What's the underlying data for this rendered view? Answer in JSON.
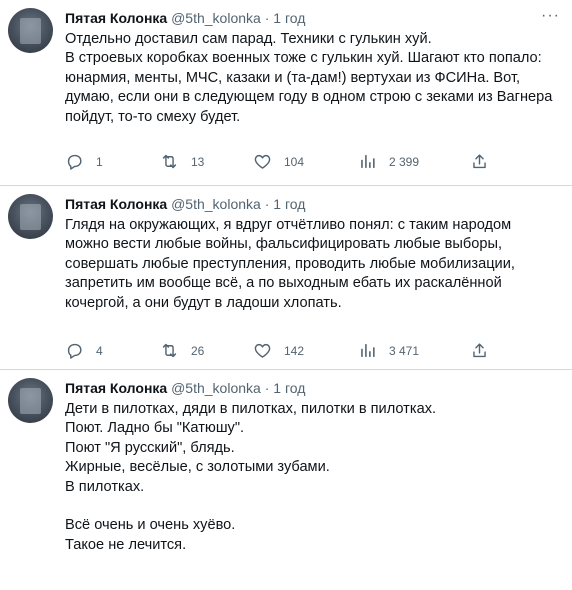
{
  "tweets": [
    {
      "name": "Пятая Колонка",
      "handle": "@5th_kolonka",
      "separator": "·",
      "time": "1 год",
      "lines": [
        "Отдельно доставил сам парад. Техники с гулькин хуй.",
        "В строевых коробках военных тоже с гулькин хуй. Шагают кто попало:",
        "юнармия, менты, МЧС, казаки и (та-дам!) вертухаи из ФСИНа. Вот,",
        "думаю, если они в следующем году в одном строю с зеками из Вагнера",
        "пойдут, то-то смеху будет."
      ],
      "replies": "1",
      "retweets": "13",
      "likes": "104",
      "views": "2 399"
    },
    {
      "name": "Пятая Колонка",
      "handle": "@5th_kolonka",
      "separator": "·",
      "time": "1 год",
      "lines": [
        "Глядя на окружающих, я вдруг отчётливо понял: с таким народом",
        "можно вести любые войны, фальсифицировать любые выборы,",
        "совершать любые преступления, проводить любые мобилизации,",
        "запретить им вообще всё, а по выходным ебать их раскалённой",
        "кочергой, а они будут в ладоши хлопать."
      ],
      "replies": "4",
      "retweets": "26",
      "likes": "142",
      "views": "3 471"
    },
    {
      "name": "Пятая Колонка",
      "handle": "@5th_kolonka",
      "separator": "·",
      "time": "1 год",
      "lines": [
        "Дети в пилотках, дяди в пилотках, пилотки в пилотках.",
        "Поют. Ладно бы \"Катюшу\".",
        "Поют \"Я русский\", блядь.",
        "Жирные, весёлые, с золотыми зубами.",
        "В пилотках.",
        "",
        "Всё очень и очень хуёво.",
        "Такое не лечится."
      ]
    }
  ]
}
